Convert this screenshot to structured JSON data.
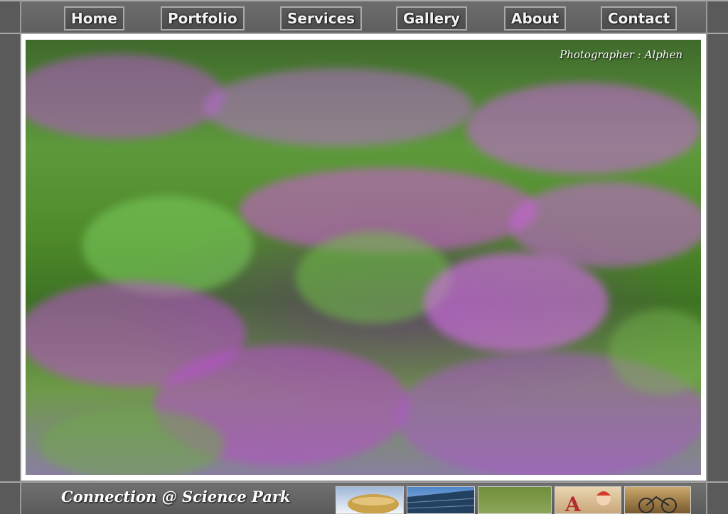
{
  "nav": {
    "items": [
      {
        "label": "Home"
      },
      {
        "label": "Portfolio"
      },
      {
        "label": "Services"
      },
      {
        "label": "Gallery"
      },
      {
        "label": "About"
      },
      {
        "label": "Contact"
      }
    ]
  },
  "photo": {
    "credit": "Photographer :  Alphen",
    "subject": "purple-flowers-photo"
  },
  "footer": {
    "title": "Connection @ Science Park",
    "thumbnails": [
      {
        "name": "thumb-airship"
      },
      {
        "name": "thumb-building"
      },
      {
        "name": "thumb-grass"
      },
      {
        "name": "thumb-cartoon"
      },
      {
        "name": "thumb-bicycle"
      }
    ]
  },
  "colors": {
    "frame": "#5e5e5e",
    "photo_border": "#ffffff",
    "nav_text": "#f2f2f2",
    "nav_button_border": "#a9a9a9"
  }
}
